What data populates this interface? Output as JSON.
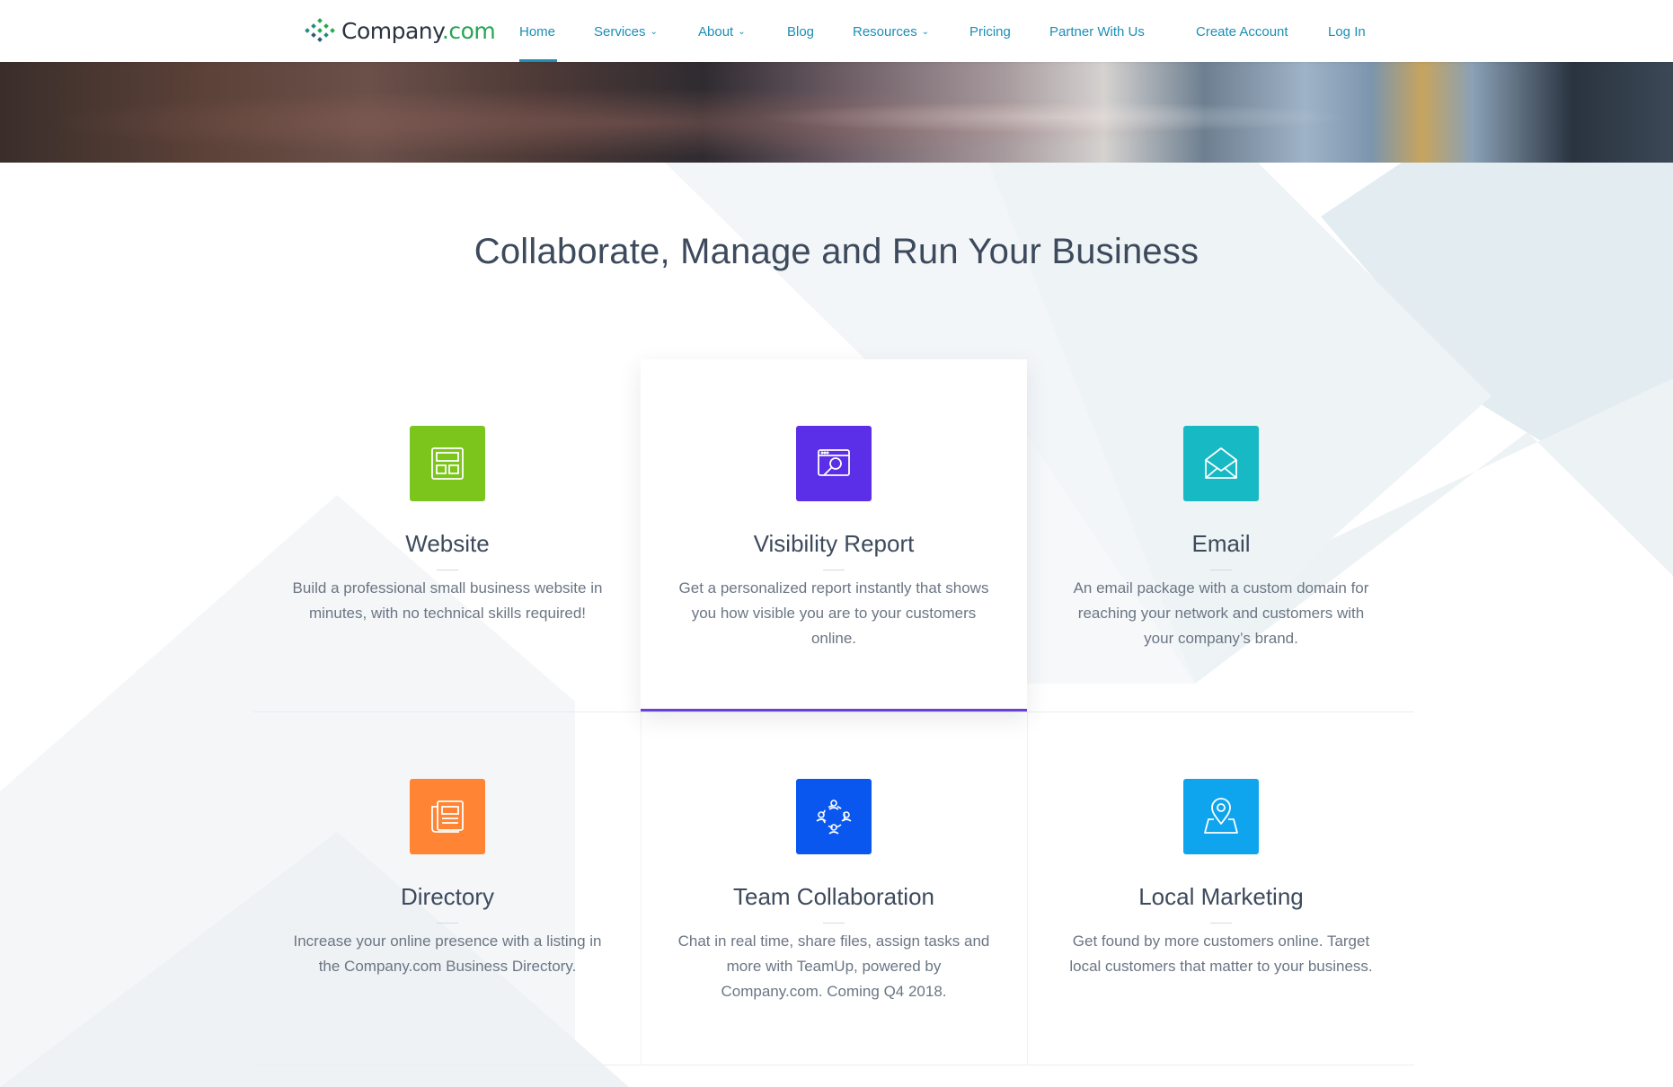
{
  "header": {
    "logo": {
      "name": "Company",
      "tld": ".com"
    },
    "nav": [
      {
        "label": "Home",
        "active": true,
        "dropdown": false
      },
      {
        "label": "Services",
        "active": false,
        "dropdown": true
      },
      {
        "label": "About",
        "active": false,
        "dropdown": true
      },
      {
        "label": "Blog",
        "active": false,
        "dropdown": false
      },
      {
        "label": "Resources",
        "active": false,
        "dropdown": true
      },
      {
        "label": "Pricing",
        "active": false,
        "dropdown": false
      },
      {
        "label": "Partner With Us",
        "active": false,
        "dropdown": false
      },
      {
        "label": "Create Account",
        "active": false,
        "dropdown": false
      },
      {
        "label": "Log In",
        "active": false,
        "dropdown": false
      }
    ]
  },
  "section": {
    "title": "Collaborate, Manage and Run Your Business"
  },
  "cards": [
    {
      "title": "Website",
      "description": "Build a professional small business website in minutes, with no technical skills required!",
      "icon": "website-layout-icon",
      "color": "#7cc51d",
      "active": false
    },
    {
      "title": "Visibility Report",
      "description": "Get a personalized report instantly that shows you how visible you are to your customers online.",
      "icon": "visibility-report-icon",
      "color": "#5b2ee8",
      "active": true
    },
    {
      "title": "Email",
      "description": "An email package with a custom domain for reaching your network and customers with your company’s brand.",
      "icon": "envelope-icon",
      "color": "#17b9c4",
      "active": false
    },
    {
      "title": "Directory",
      "description": "Increase your online presence with a listing in the Company.com Business Directory.",
      "icon": "directory-listing-icon",
      "color": "#ff8434",
      "active": false
    },
    {
      "title": "Team Collaboration",
      "description": "Chat in real time, share files, assign tasks and more with TeamUp, powered by Company.com. Coming Q4 2018.",
      "icon": "team-collaboration-icon",
      "color": "#0a57f0",
      "active": false
    },
    {
      "title": "Local Marketing",
      "description": "Get found by more customers online. Target local customers that matter to your business.",
      "icon": "map-pin-icon",
      "color": "#0ea4ee",
      "active": false
    }
  ]
}
